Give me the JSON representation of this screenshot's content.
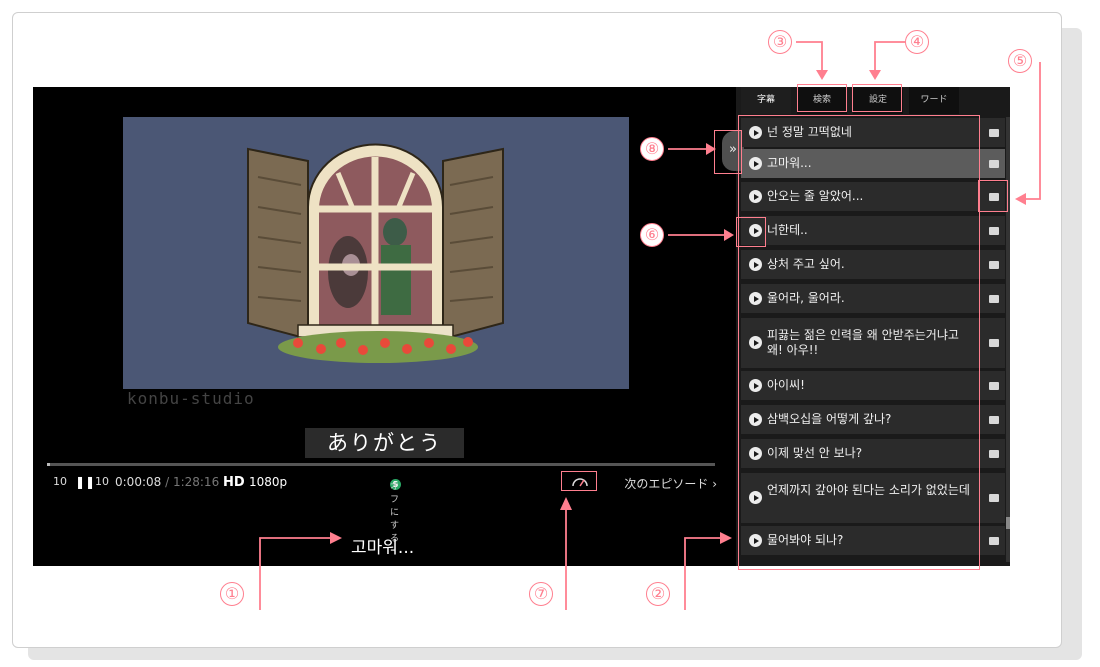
{
  "player": {
    "watermark": "konbu-studio",
    "subtitle_jp": "ありがとう",
    "bottom_subtitle": "고마워...",
    "progress": 0.001,
    "controls": {
      "rewind_label": "10",
      "pause_icon": "pause-icon",
      "forward_label": "10",
      "current_time": "0:00:08",
      "total_time": " / 1:28:16",
      "quality_badge": "HD",
      "resolution": "1080p",
      "subtitle_toggle_badge": "S",
      "subtitle_toggle_label": "オフにする",
      "speed_icon": "speedometer-icon",
      "next_episode": "次のエピソード ›"
    }
  },
  "panel": {
    "tabs": [
      {
        "label": "字幕"
      },
      {
        "label": "検索"
      },
      {
        "label": "設定"
      },
      {
        "label": "ワード"
      }
    ],
    "collapse_label": "»",
    "subtitles": [
      {
        "text": "넌 정말 끄떡없네"
      },
      {
        "text": "고마워..."
      },
      {
        "text": "안오는 줄 알았어..."
      },
      {
        "text": "너한테.."
      },
      {
        "text": "상처 주고 싶어."
      },
      {
        "text": "울어라, 울어라."
      },
      {
        "text": "피끓는 젊은 인력을 왜 안받주는거냐고 왜! 아우!!"
      },
      {
        "text": "아이씨!"
      },
      {
        "text": "삼백오십을 어떻게 갚나?"
      },
      {
        "text": "이제 맞선 안 보나?"
      },
      {
        "text": "언제까지 갚아야 된다는 소리가 없었는데"
      },
      {
        "text": "물어봐야 되나?"
      }
    ]
  },
  "annotations": {
    "n1": "①",
    "n2": "②",
    "n3": "③",
    "n4": "④",
    "n5": "⑤",
    "n6": "⑥",
    "n7": "⑦",
    "n8": "⑧",
    "color": "#ff7f8f"
  }
}
